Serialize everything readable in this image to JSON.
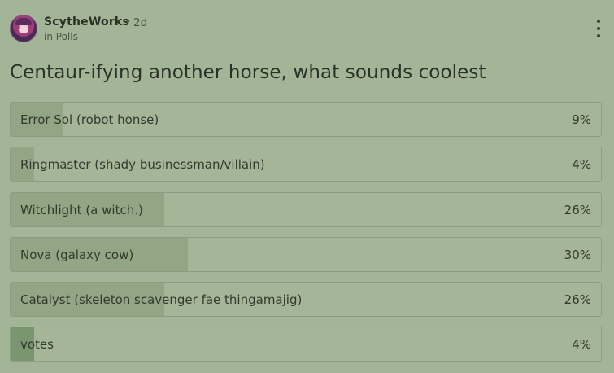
{
  "post": {
    "author": "ScytheWorks",
    "separator": "•",
    "time": "2d",
    "community": "in Polls",
    "avatar_icon": "user-avatar-icon",
    "menu_icon": "vertical-ellipsis-icon"
  },
  "poll": {
    "title": "Centaur-ifying another horse, what sounds coolest",
    "options": [
      {
        "label": "Error Sol (robot honse)",
        "percent_text": "9%",
        "percent": 9
      },
      {
        "label": "Ringmaster (shady businessman/villain)",
        "percent_text": "4%",
        "percent": 4
      },
      {
        "label": "Witchlight (a witch.)",
        "percent_text": "26%",
        "percent": 26
      },
      {
        "label": "Nova (galaxy cow)",
        "percent_text": "30%",
        "percent": 30
      },
      {
        "label": "Catalyst (skeleton scavenger fae thingamajig)",
        "percent_text": "26%",
        "percent": 26
      },
      {
        "label": "votes",
        "percent_text": "4%",
        "percent": 4,
        "selected": true
      }
    ]
  },
  "colors": {
    "background": "#a3b597",
    "bar_fill": "#92a585",
    "selected_fill": "#7a9670",
    "text": "#2d3328"
  }
}
